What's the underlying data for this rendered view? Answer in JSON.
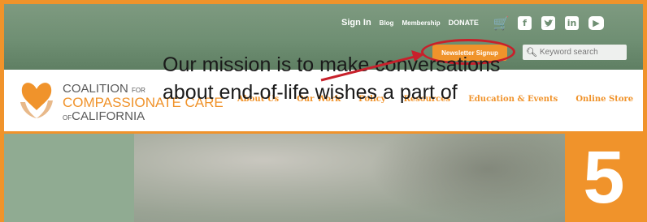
{
  "top_nav": {
    "sign_in": "Sign In",
    "blog": "Blog",
    "membership": "Membership",
    "donate": "DONATE"
  },
  "social": {
    "cart": "cart-icon",
    "facebook": "f",
    "twitter": "t",
    "linkedin": "in",
    "youtube": "▶"
  },
  "newsletter_label": "Newsletter Signup",
  "search": {
    "placeholder": "Keyword search"
  },
  "logo": {
    "line1": "COALITION",
    "line1_small": "FOR",
    "line2": "COMPASSIONATE CARE",
    "line3_small": "OF",
    "line3": "CALIFORNIA"
  },
  "main_nav": [
    "About Us",
    "Our Work",
    "Policy",
    "Resources",
    "Education & Events",
    "Online Store"
  ],
  "hero": {
    "mission_line1": "Our mission is to make conversations",
    "mission_line2": "about end-of-life wishes a part of"
  },
  "step_badge": "5",
  "colors": {
    "accent": "#f0932b",
    "header_green": "#6f8f73",
    "annotation_red": "#c8202b"
  }
}
